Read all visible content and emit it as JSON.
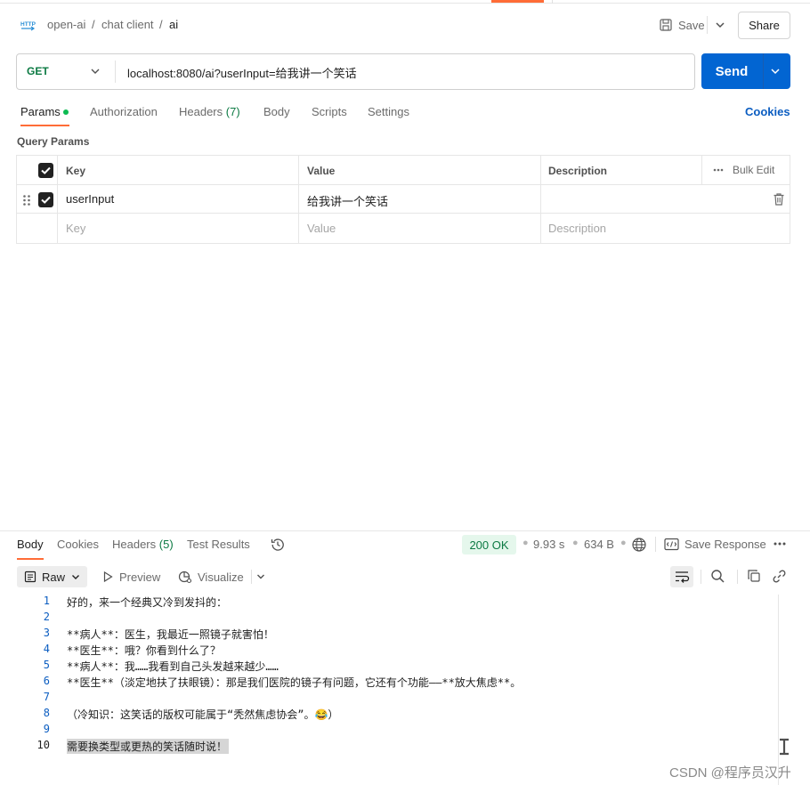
{
  "breadcrumb": {
    "items": [
      "open-ai",
      "chat client",
      "ai"
    ],
    "separator": "/"
  },
  "header": {
    "save_label": "Save",
    "share_label": "Share"
  },
  "request": {
    "method": "GET",
    "url": "localhost:8080/ai?userInput=给我讲一个笑话",
    "send_label": "Send"
  },
  "request_tabs": {
    "params": "Params",
    "authorization": "Authorization",
    "headers": "Headers",
    "headers_count": "(7)",
    "body": "Body",
    "scripts": "Scripts",
    "settings": "Settings",
    "cookies": "Cookies"
  },
  "query_params": {
    "title": "Query Params",
    "columns": {
      "key": "Key",
      "value": "Value",
      "description": "Description"
    },
    "bulk_edit": "Bulk Edit",
    "rows": [
      {
        "key": "userInput",
        "value": "给我讲一个笑话",
        "description": "",
        "enabled": true
      }
    ],
    "placeholder": {
      "key": "Key",
      "value": "Value",
      "description": "Description"
    }
  },
  "response_tabs": {
    "body": "Body",
    "cookies": "Cookies",
    "headers": "Headers",
    "headers_count": "(5)",
    "test_results": "Test Results"
  },
  "response_meta": {
    "status": "200 OK",
    "time": "9.93 s",
    "size": "634 B",
    "save_response": "Save Response"
  },
  "response_toolbar": {
    "format": "Raw",
    "preview": "Preview",
    "visualize": "Visualize"
  },
  "response_body": {
    "lines": [
      {
        "n": "1",
        "text": "好的，来一个经典又冷到发抖的："
      },
      {
        "n": "2",
        "text": ""
      },
      {
        "n": "3",
        "text": "**病人**：医生，我最近一照镜子就害怕！"
      },
      {
        "n": "4",
        "text": "**医生**：哦？你看到什么了？"
      },
      {
        "n": "5",
        "text": "**病人**：我……我看到自己头发越来越少……"
      },
      {
        "n": "6",
        "text": "**医生**（淡定地扶了扶眼镜）：那是我们医院的镜子有问题，它还有个功能——**放大焦虑**。"
      },
      {
        "n": "7",
        "text": ""
      },
      {
        "n": "8",
        "text": "（冷知识：这笑话的版权可能属于“秃然焦虑协会”。😂）"
      },
      {
        "n": "9",
        "text": ""
      },
      {
        "n": "10",
        "text": "需要换类型或更热的笑话随时说！"
      }
    ]
  },
  "watermark": "CSDN @程序员汉升",
  "colors": {
    "accent": "#ff6c37",
    "send": "#0265d2",
    "method_get": "#0c7a43",
    "status_ok_bg": "#e5f7ec",
    "link": "#0b5dc1"
  }
}
